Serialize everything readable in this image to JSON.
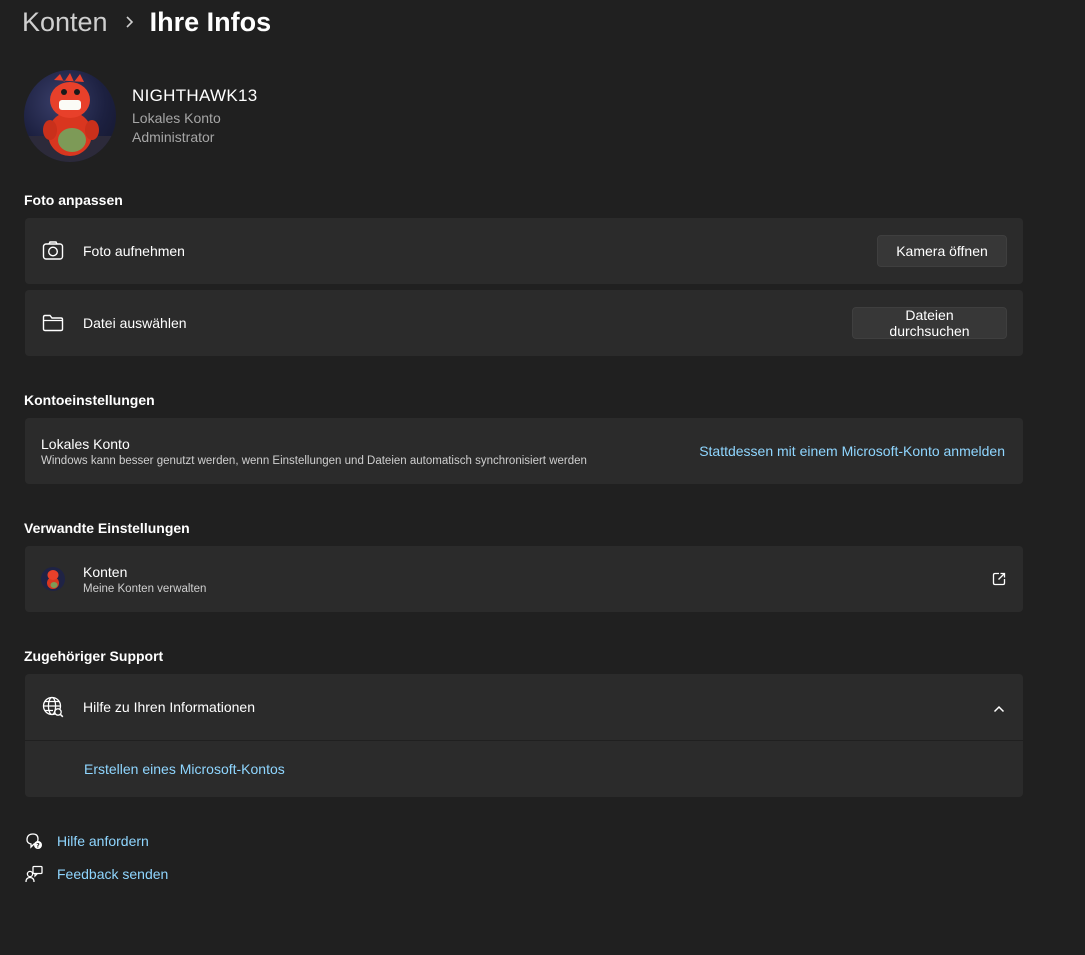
{
  "breadcrumb": {
    "parent": "Konten",
    "current": "Ihre Infos"
  },
  "profile": {
    "name": "NIGHTHAWK13",
    "account_type": "Lokales Konto",
    "role": "Administrator"
  },
  "photo_section": {
    "heading": "Foto anpassen",
    "take_photo": {
      "label": "Foto aufnehmen",
      "button": "Kamera öffnen"
    },
    "choose_file": {
      "label": "Datei auswählen",
      "button": "Dateien durchsuchen"
    }
  },
  "account_settings": {
    "heading": "Kontoeinstellungen",
    "title": "Lokales Konto",
    "description": "Windows kann besser genutzt werden, wenn Einstellungen und Dateien automatisch synchronisiert werden",
    "link": "Stattdessen mit einem Microsoft-Konto anmelden"
  },
  "related_settings": {
    "heading": "Verwandte Einstellungen",
    "title": "Konten",
    "description": "Meine Konten verwalten"
  },
  "support": {
    "heading": "Zugehöriger Support",
    "help_title": "Hilfe zu Ihren Informationen",
    "link": "Erstellen eines Microsoft-Kontos"
  },
  "footer": {
    "get_help": "Hilfe anfordern",
    "feedback": "Feedback senden"
  },
  "colors": {
    "background": "#202020",
    "card": "#2b2b2b",
    "accent_link": "#8fd6ff"
  }
}
